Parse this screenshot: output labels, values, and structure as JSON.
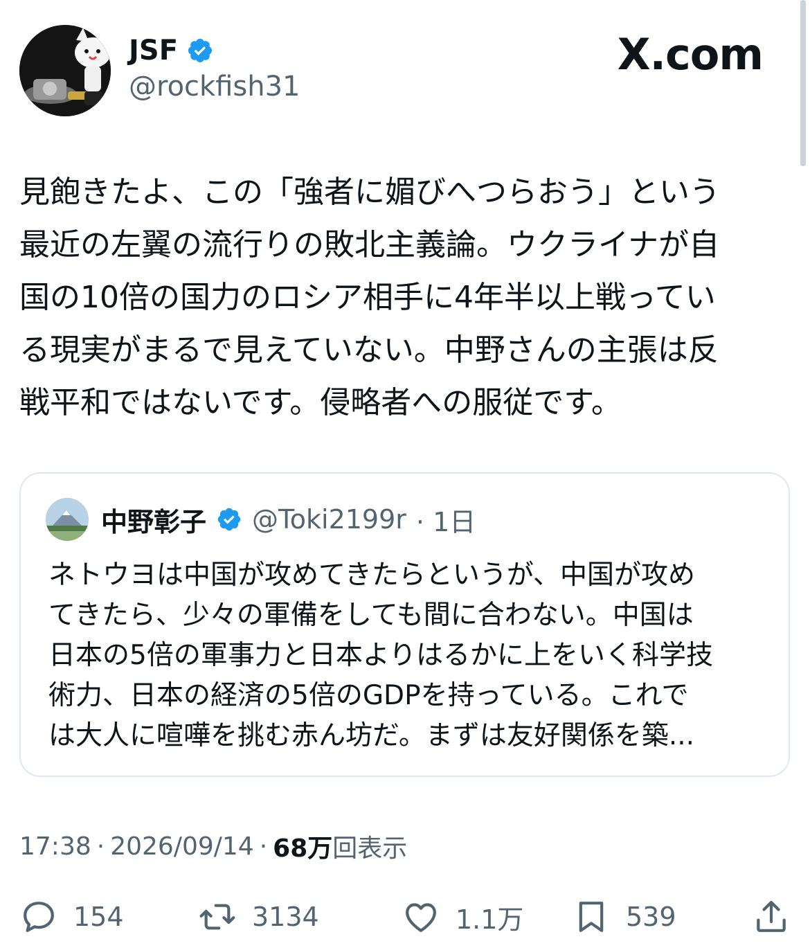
{
  "author": {
    "display_name": "JSF",
    "handle": "@rockfish31",
    "verified": true
  },
  "source_logo": "X.com",
  "tweet": {
    "text": "見飽きたよ、この「強者に媚びへつらおう」という\n最近の左翼の流行りの敗北主義論。ウクライナが自\n国の10倍の国力のロシア相手に4年半以上戦ってい\nる現実がまるで見えていない。中野さんの主張は反\n戦平和ではないです。侵略者への服従です。"
  },
  "quoted_tweet": {
    "display_name": "中野彰子",
    "handle": "@Toki2199r",
    "age": "· 1日",
    "verified": true,
    "text": "ネトウヨは中国が攻めてきたらというが、中国が攻め\nてきたら、少々の軍備をしても間に合わない。中国は\n日本の5倍の軍事力と日本よりはるかに上をいく科学技\n術力、日本の経済の5倍のGDPを持っている。これで\nは大人に喧嘩を挑む赤ん坊だ。まずは友好関係を築..."
  },
  "meta": {
    "time": "17:38",
    "sep1": "·",
    "date": "2026/09/14",
    "sep2": "·",
    "views_count": "68万",
    "views_label": "回表示"
  },
  "actions": {
    "replies": "154",
    "reposts": "3134",
    "likes": "1.1万",
    "bookmarks": "539"
  },
  "colors": {
    "text": "#0f1419",
    "secondary": "#536471",
    "verified": "#1d9bf0",
    "border": "#e1e8ed"
  }
}
